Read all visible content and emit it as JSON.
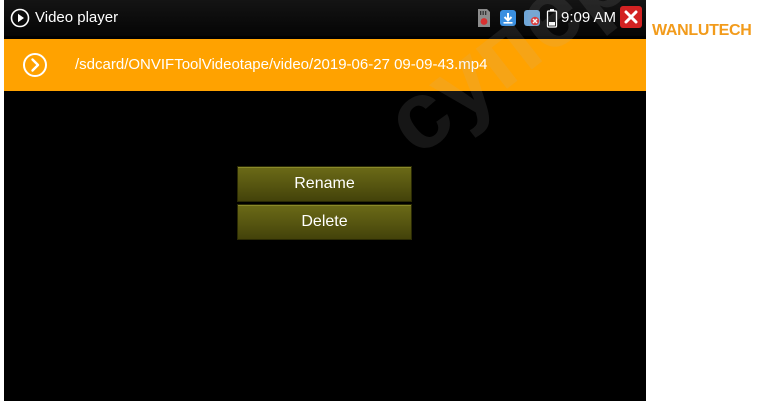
{
  "app": {
    "title": "Video player",
    "icon": "play-circle-icon"
  },
  "status_bar": {
    "time": "9:09 AM",
    "icons": [
      "sd-card-icon",
      "download-icon",
      "no-network-icon",
      "battery-icon",
      "close-icon"
    ]
  },
  "path_bar": {
    "path": "/sdcard/ONVIFToolVideotape/video/2019-06-27 09-09-43.mp4",
    "icon": "play-circle-icon"
  },
  "menu": {
    "rename_label": "Rename",
    "delete_label": "Delete"
  },
  "branding": {
    "side_logo": "WANLUTECH",
    "watermark": "суперайс"
  },
  "colors": {
    "accent": "#ffa200",
    "button": "#5a5912",
    "close": "#d32222"
  }
}
